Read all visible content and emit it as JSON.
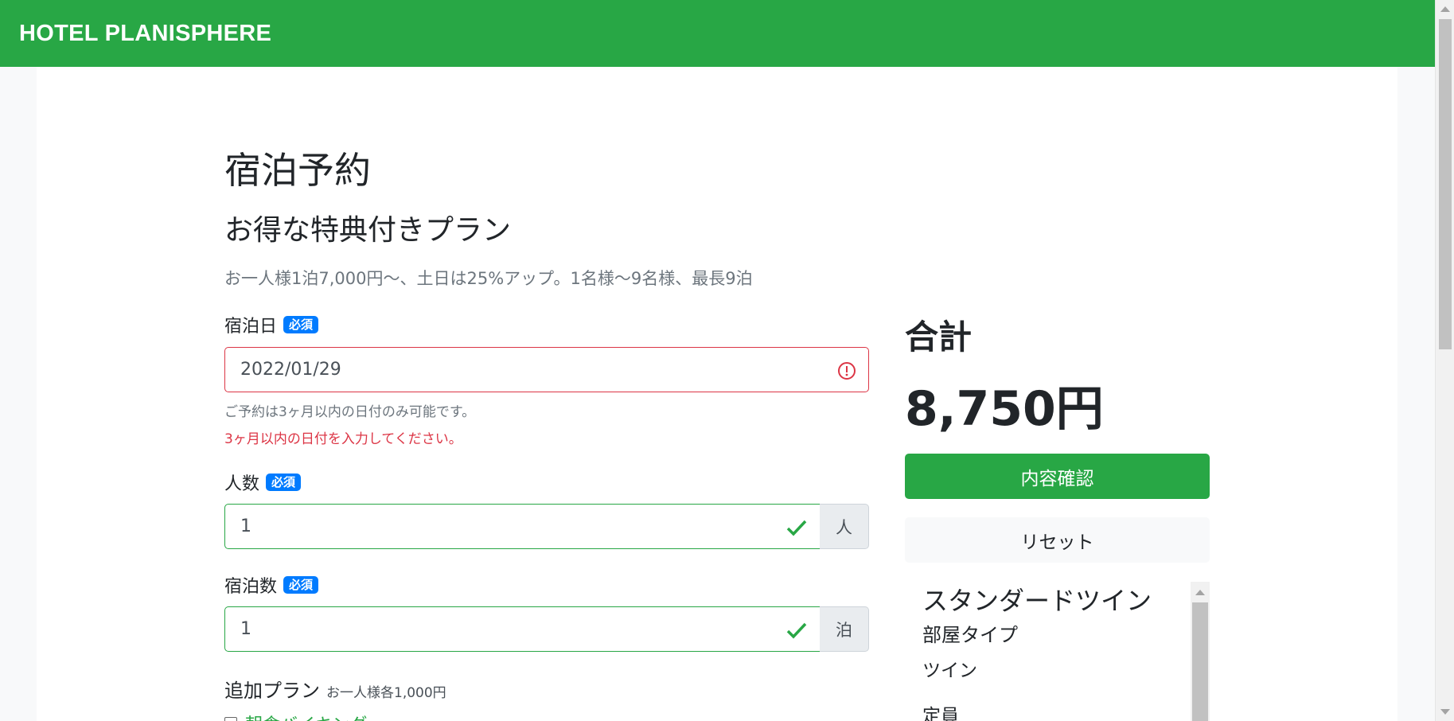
{
  "header": {
    "brand": "HOTEL PLANISPHERE"
  },
  "page": {
    "title": "宿泊予約",
    "plan_name": "お得な特典付きプラン",
    "plan_description": "お一人様1泊7,000円〜、土日は25%アップ。1名様〜9名様、最長9泊"
  },
  "form": {
    "required_badge": "必須",
    "date": {
      "label": "宿泊日",
      "value": "2022/01/29",
      "help": "ご予約は3ヶ月以内の日付のみ可能です。",
      "error": "3ヶ月以内の日付を入力してください。"
    },
    "head_count": {
      "label": "人数",
      "value": "1",
      "unit": "人"
    },
    "term": {
      "label": "宿泊数",
      "value": "1",
      "unit": "泊"
    },
    "additional_plans": {
      "label": "追加プラン",
      "note": "お一人様各1,000円",
      "options": [
        {
          "label": "朝食バイキング",
          "checked": false
        }
      ]
    }
  },
  "summary": {
    "total_label": "合計",
    "total_price": "8,750円",
    "confirm_button": "内容確認",
    "reset_button": "リセット"
  },
  "room": {
    "name": "スタンダードツイン",
    "type_label": "部屋タイプ",
    "type_value": "ツイン",
    "capacity_label": "定員"
  },
  "colors": {
    "brand": "#28a745",
    "badge": "#007bff",
    "error": "#dc3545"
  }
}
